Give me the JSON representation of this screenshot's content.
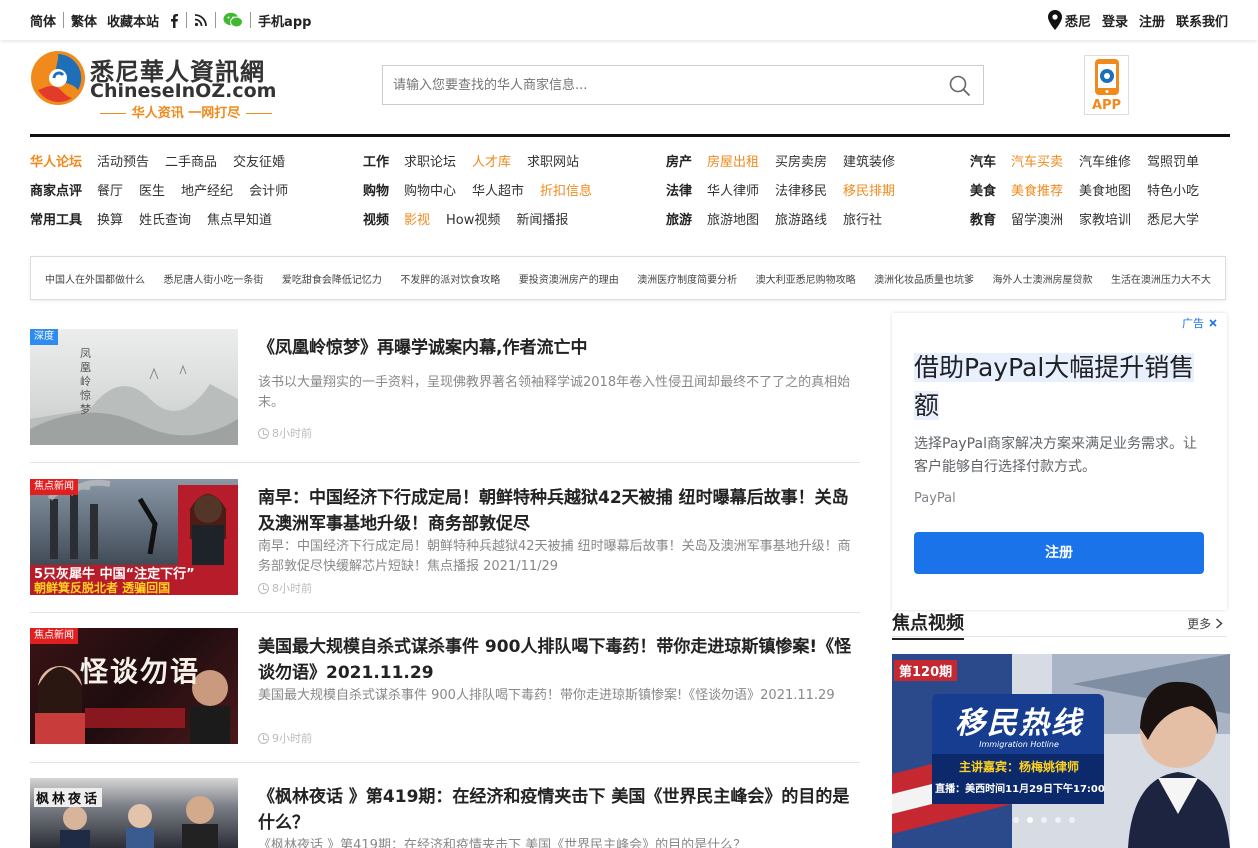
{
  "topbar": {
    "simplified": "简体",
    "traditional": "繁体",
    "bookmark": "收藏本站",
    "mobile_app": "手机app",
    "location": "悉尼",
    "login": "登录",
    "register": "注册",
    "contact": "联系我们"
  },
  "logo": {
    "name_cn": "悉尼華人資訊網",
    "name_en": "ChineseInOZ.com",
    "slogan": "华人资讯 一网打尽"
  },
  "search": {
    "placeholder": "请输入您要查找的华人商家信息..."
  },
  "app_button": {
    "label": "APP"
  },
  "nav": {
    "col1": [
      {
        "head": "华人论坛",
        "head_orange": true,
        "items": [
          {
            "t": "活动预告"
          },
          {
            "t": "二手商品"
          },
          {
            "t": "交友征婚"
          }
        ]
      },
      {
        "head": "商家点评",
        "items": [
          {
            "t": "餐厅"
          },
          {
            "t": "医生"
          },
          {
            "t": "地产经纪"
          },
          {
            "t": "会计师"
          }
        ]
      },
      {
        "head": "常用工具",
        "items": [
          {
            "t": "换算"
          },
          {
            "t": "姓氏查询"
          },
          {
            "t": "焦点早知道"
          }
        ]
      }
    ],
    "col2": [
      {
        "head": "工作",
        "items": [
          {
            "t": "求职论坛"
          },
          {
            "t": "人才库",
            "o": true
          },
          {
            "t": "求职网站"
          }
        ]
      },
      {
        "head": "购物",
        "items": [
          {
            "t": "购物中心"
          },
          {
            "t": "华人超市"
          },
          {
            "t": "折扣信息",
            "o": true
          }
        ]
      },
      {
        "head": "视频",
        "items": [
          {
            "t": "影视",
            "o": true
          },
          {
            "t": "How视频"
          },
          {
            "t": "新闻播报"
          }
        ]
      }
    ],
    "col3": [
      {
        "head": "房产",
        "items": [
          {
            "t": "房屋出租",
            "o": true
          },
          {
            "t": "买房卖房"
          },
          {
            "t": "建筑装修"
          }
        ]
      },
      {
        "head": "法律",
        "items": [
          {
            "t": "华人律师"
          },
          {
            "t": "法律移民"
          },
          {
            "t": "移民排期",
            "o": true
          }
        ]
      },
      {
        "head": "旅游",
        "items": [
          {
            "t": "旅游地图"
          },
          {
            "t": "旅游路线"
          },
          {
            "t": "旅行社"
          }
        ]
      }
    ],
    "col4": [
      {
        "head": "汽车",
        "items": [
          {
            "t": "汽车买卖",
            "o": true
          },
          {
            "t": "汽车维修"
          },
          {
            "t": "驾照罚单"
          }
        ]
      },
      {
        "head": "美食",
        "items": [
          {
            "t": "美食推荐",
            "o": true
          },
          {
            "t": "美食地图"
          },
          {
            "t": "特色小吃"
          }
        ]
      },
      {
        "head": "教育",
        "items": [
          {
            "t": "留学澳洲"
          },
          {
            "t": "家教培训"
          },
          {
            "t": "悉尼大学"
          }
        ]
      }
    ]
  },
  "hot_links": [
    "中国人在外国都做什么",
    "悉尼唐人街小吃一条街",
    "爱吃甜食会降低记忆力",
    "不发胖的派对饮食攻略",
    "要投资澳洲房产的理由",
    "澳洲医疗制度简要分析",
    "澳大利亚悉尼购物攻略",
    "澳洲化妆品质量也坑爹",
    "海外人士澳洲房屋贷款",
    "生活在澳洲压力大不大"
  ],
  "articles": [
    {
      "tag": "深度",
      "tag_color": "#2d8cf0",
      "title": "《凤凰岭惊梦》再曝学诚案内幕,作者流亡中",
      "desc": "该书以大量翔实的一手资料，呈现佛教界著名领袖释学诚2018年卷入性侵丑闻却最终不了了之的真相始末。",
      "time": "8小时前",
      "thumb_text": "凤凰岭惊梦"
    },
    {
      "tag": "焦点新闻",
      "tag_color": "#e02020",
      "title": "南早：中国经济下行成定局！朝鲜特种兵越狱42天被捕 纽时曝幕后故事！关岛及澳洲军事基地升级！商务部敦促尽",
      "desc": "南早：中国经济下行成定局！朝鲜特种兵越狱42天被捕 纽时曝幕后故事！关岛及澳洲军事基地升级！商务部敦促尽快缓解芯片短缺！焦点播报 2021/11/29",
      "time": "8小时前",
      "thumb_text": "5只灰犀牛 中国“注定下行”",
      "thumb_text2": "朝鲜箕反脱北者 透骗回国"
    },
    {
      "tag": "焦点新闻",
      "tag_color": "#e02020",
      "title": "美国最大规模自杀式谋杀事件 900人排队喝下毒药！带你走进琼斯镇惨案!《怪谈勿语》2021.11.29",
      "desc": "美国最大规模自杀式谋杀事件 900人排队喝下毒药！带你走进琼斯镇惨案!《怪谈勿语》2021.11.29",
      "time": "9小时前",
      "thumb_text": "怪谈勿语"
    },
    {
      "tag": "",
      "tag_color": "#e02020",
      "title": "《枫林夜话 》第419期：在经济和疫情夹击下 美国《世界民主峰会》的目的是什么？",
      "desc": "《枫林夜话 》第419期：在经济和疫情夹击下 美国《世界民主峰会》的目的是什么？",
      "time": "",
      "thumb_text": "枫林夜话"
    }
  ],
  "ad": {
    "label": "广告",
    "headline": "借助PayPal大幅提升销售额",
    "body": "选择PayPal商家解决方案来满足业务需求。让客户能够自行选择付款方式。",
    "brand": "PayPal",
    "cta": "注册"
  },
  "video": {
    "title": "焦点视频",
    "more": "更多",
    "episode": "第120期",
    "show": "移民热线",
    "show_en": "Immigration Hotline",
    "guest": "主讲嘉宾：杨梅姚律师",
    "air": "直播：美西时间11月29日下午17:00"
  }
}
